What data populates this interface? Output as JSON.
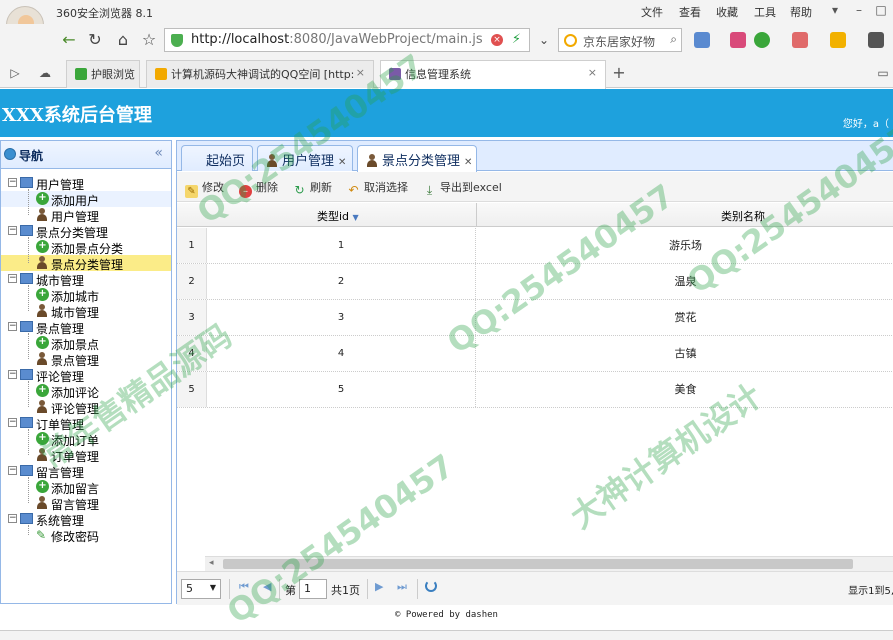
{
  "browser": {
    "app_title": "360安全浏览器 8.1",
    "menus": [
      "文件",
      "查看",
      "收藏",
      "工具",
      "帮助"
    ],
    "url_host": "http://localhost",
    "url_rest": ":8080/JavaWebProject/main.js",
    "search_placeholder": "京东居家好物",
    "tabs": [
      {
        "label": "护眼浏览",
        "color": "#3aa63a"
      },
      {
        "label": "计算机源码大神调试的QQ空间 [http:",
        "color": "#f2a900"
      },
      {
        "label": "信息管理系统",
        "color": "#7a5aa8"
      }
    ]
  },
  "header": {
    "title": "XXX系统后台管理",
    "greeting": "您好，a（"
  },
  "sidebar": {
    "title": "导航",
    "groups": [
      {
        "label": "用户管理",
        "children": [
          {
            "label": "添加用户",
            "type": "add"
          },
          {
            "label": "用户管理",
            "type": "user"
          }
        ]
      },
      {
        "label": "景点分类管理",
        "children": [
          {
            "label": "添加景点分类",
            "type": "add"
          },
          {
            "label": "景点分类管理",
            "type": "user"
          }
        ]
      },
      {
        "label": "城市管理",
        "children": [
          {
            "label": "添加城市",
            "type": "add"
          },
          {
            "label": "城市管理",
            "type": "user"
          }
        ]
      },
      {
        "label": "景点管理",
        "children": [
          {
            "label": "添加景点",
            "type": "add"
          },
          {
            "label": "景点管理",
            "type": "user"
          }
        ]
      },
      {
        "label": "评论管理",
        "children": [
          {
            "label": "添加评论",
            "type": "add"
          },
          {
            "label": "评论管理",
            "type": "user"
          }
        ]
      },
      {
        "label": "订单管理",
        "children": [
          {
            "label": "添加订单",
            "type": "add"
          },
          {
            "label": "订单管理",
            "type": "user"
          }
        ]
      },
      {
        "label": "留言管理",
        "children": [
          {
            "label": "添加留言",
            "type": "add"
          },
          {
            "label": "留言管理",
            "type": "user"
          }
        ]
      },
      {
        "label": "系统管理",
        "children": [
          {
            "label": "修改密码",
            "type": "pencil"
          }
        ]
      }
    ]
  },
  "main": {
    "tabs": [
      {
        "label": "起始页",
        "closable": false
      },
      {
        "label": "用户管理",
        "closable": true
      },
      {
        "label": "景点分类管理",
        "closable": true,
        "active": true
      }
    ],
    "toolbar": {
      "edit": "修改",
      "delete": "删除",
      "refresh": "刷新",
      "cancel": "取消选择",
      "export": "导出到excel"
    },
    "grid": {
      "columns": [
        "类型id",
        "类别名称"
      ],
      "rows": [
        {
          "no": "1",
          "id": "1",
          "name": "游乐场"
        },
        {
          "no": "2",
          "id": "2",
          "name": "温泉"
        },
        {
          "no": "3",
          "id": "3",
          "name": "赏花"
        },
        {
          "no": "4",
          "id": "4",
          "name": "古镇"
        },
        {
          "no": "5",
          "id": "5",
          "name": "美食"
        }
      ]
    },
    "pager": {
      "page_size": "5",
      "page_prefix": "第",
      "page_value": "1",
      "page_suffix": "共1页",
      "info": "显示1到5,"
    }
  },
  "footer": {
    "text": "© Powered by dashen"
  },
  "watermarks": [
    "QQ:254540457",
    "常年售精品源码",
    "大神计算机设计"
  ]
}
